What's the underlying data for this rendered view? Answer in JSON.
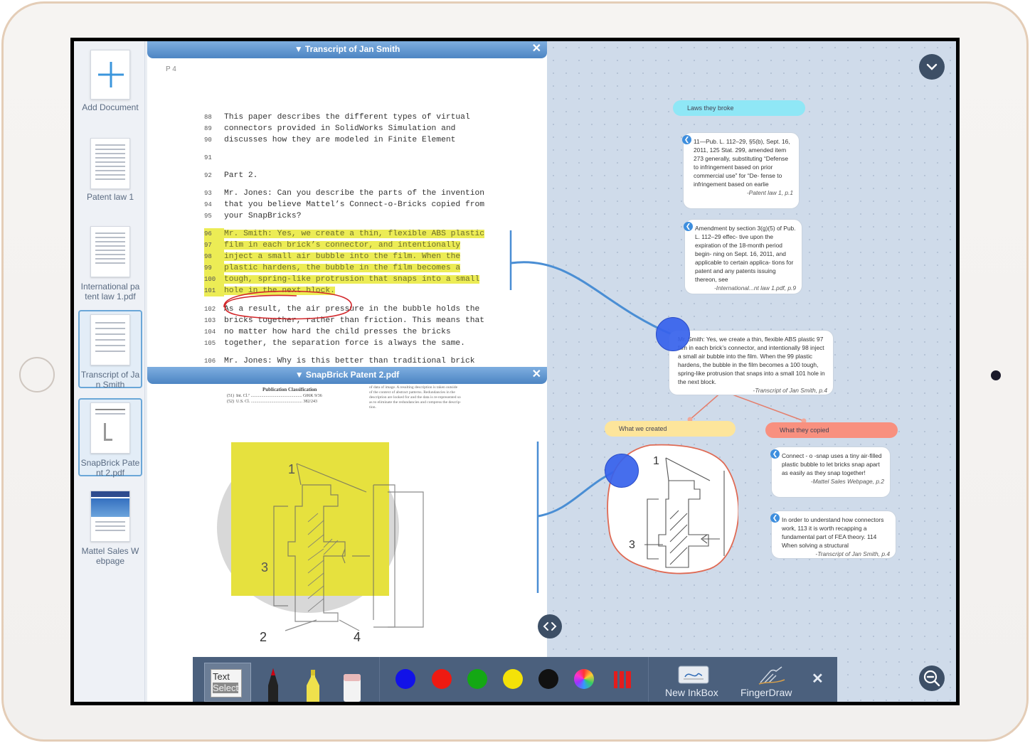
{
  "sidebar": {
    "add_document": "Add Document",
    "items": [
      {
        "label_l1": "Patent law 1",
        "label_l2": ""
      },
      {
        "label_l1": "International pa",
        "label_l2": "tent law 1.pdf"
      },
      {
        "label_l1": "Transcript of Ja",
        "label_l2": "n Smith"
      },
      {
        "label_l1": "SnapBrick Pate",
        "label_l2": "nt 2.pdf"
      },
      {
        "label_l1": "Mattel Sales W",
        "label_l2": "ebpage"
      }
    ]
  },
  "doc1": {
    "title": "▼ Transcript of Jan Smith",
    "close": "✕",
    "page_label": "P 4",
    "lines": [
      {
        "n": "88",
        "t": "This paper describes the different types of virtual",
        "hl": false
      },
      {
        "n": "89",
        "t": "connectors provided in SolidWorks Simulation and",
        "hl": false
      },
      {
        "n": "90",
        "t": "discusses how they are modeled in Finite Element",
        "hl": false
      },
      {
        "n": "91",
        "t": "",
        "hl": false
      },
      {
        "n": "92",
        "t": "Part 2.",
        "hl": false
      },
      {
        "n": "93",
        "t": "Mr. Jones: Can you describe the parts of the invention",
        "hl": false
      },
      {
        "n": "94",
        "t": "that you believe Mattel’s Connect-o-Bricks copied from",
        "hl": false
      },
      {
        "n": "95",
        "t": "your SnapBricks?",
        "hl": false
      },
      {
        "n": "96",
        "t": "Mr. Smith: Yes, we create a thin, flexible ABS plastic",
        "hl": true
      },
      {
        "n": "97",
        "t": "film in each brick’s connector, and intentionally",
        "hl": true
      },
      {
        "n": "98",
        "t": "inject a small air bubble into the film. When the",
        "hl": true
      },
      {
        "n": "99",
        "t": "plastic hardens, the bubble in the film becomes a",
        "hl": true
      },
      {
        "n": "100",
        "t": "tough, spring-like protrusion that snaps into a small",
        "hl": true
      },
      {
        "n": "101",
        "t": "hole in the next block.",
        "hl": true
      },
      {
        "n": "102",
        "t": "As a result, the air pressure in the bubble holds the",
        "hl": false
      },
      {
        "n": "103",
        "t": "bricks together, rather than friction. This means that",
        "hl": false
      },
      {
        "n": "104",
        "t": "no matter how hard the child presses the bricks",
        "hl": false
      },
      {
        "n": "105",
        "t": "together, the separation force is always the same.",
        "hl": false
      },
      {
        "n": "106",
        "t": "Mr. Jones: Why is this better than traditional brick",
        "hl": false
      }
    ]
  },
  "doc2": {
    "title": "▼ SnapBrick Patent 2.pdf",
    "close": "✕",
    "pub_class": "Publication Classification",
    "pub_rows": [
      {
        "code": "(51)",
        "name": "Int. Cl.⁷",
        "value": "G06K 9/36"
      },
      {
        "code": "(52)",
        "name": "U.S. Cl.",
        "value": "382/243"
      }
    ],
    "pub_text": [
      "of data of image. A resulting description is taken outside",
      "of the context of abstract patterns. Redundancies in the",
      "description are looked for and the data is re-represented so",
      "as to eliminate the redundancies and compress the descrip-",
      "tion."
    ],
    "fig_labels": [
      "1",
      "3",
      "2",
      "4"
    ]
  },
  "notes": {
    "laws": {
      "header": "Laws they broke",
      "cards": [
        {
          "text": "11—Pub. L. 112–29, §5(b), Sept. 16, 2011, 125 Stat. 299, amended item 273 generally, substituting “Defense to infringement based on prior commercial use” for “De- fense to infringement based on earlie",
          "src": "-Patent law 1, p.1"
        },
        {
          "text": "Amendment by section 3(g)(5) of Pub. L. 112–29 effec- tive upon the expiration of the 18-month period begin- ning on Sept. 16, 2011, and applicable to certain applica- tions for patent and any patents issuing thereon, see",
          "src": "-International...nt law 1.pdf, p.9"
        }
      ]
    },
    "main": {
      "text": "Mr. Smith: Yes, we create a thin, flexible ABS plastic 97 film in each brick’s connector, and intentionally 98 inject a small air bubble into the film. When the 99 plastic hardens, the bubble in the film becomes a 100 tough, spring-like protrusion that snaps into a small 101 hole in the next block.",
      "src": "-Transcript of Jan Smith, p.4"
    },
    "created": {
      "header": "What we created",
      "fig_labels": [
        "1",
        "3"
      ]
    },
    "copied": {
      "header": "What they copied",
      "cards": [
        {
          "text": "Connect - o -snap uses a tiny air-filled plastic bubble to let bricks snap apart as easily as they snap together!",
          "src": "-Mattel Sales Webpage, p.2"
        },
        {
          "text": "In order to understand how connectors work, 113 it is worth recapping a fundamental part of FEA theory. 114 When solving a structural",
          "src": "-Transcript of Jan Smith, p.4"
        }
      ]
    }
  },
  "toolbar": {
    "text_select_l1": "Text",
    "text_select_l2": "Select",
    "colors": [
      "#1212e8",
      "#ee1a12",
      "#14a814",
      "#f4e208",
      "#111111"
    ],
    "new_inkbox": "New InkBox",
    "finger_draw": "FingerDraw",
    "close": "✕"
  },
  "icons": {
    "collapse": "chevron-down-icon",
    "zoom": "zoom-out-icon",
    "split": "split-arrows-icon",
    "back": "back-link-icon"
  }
}
